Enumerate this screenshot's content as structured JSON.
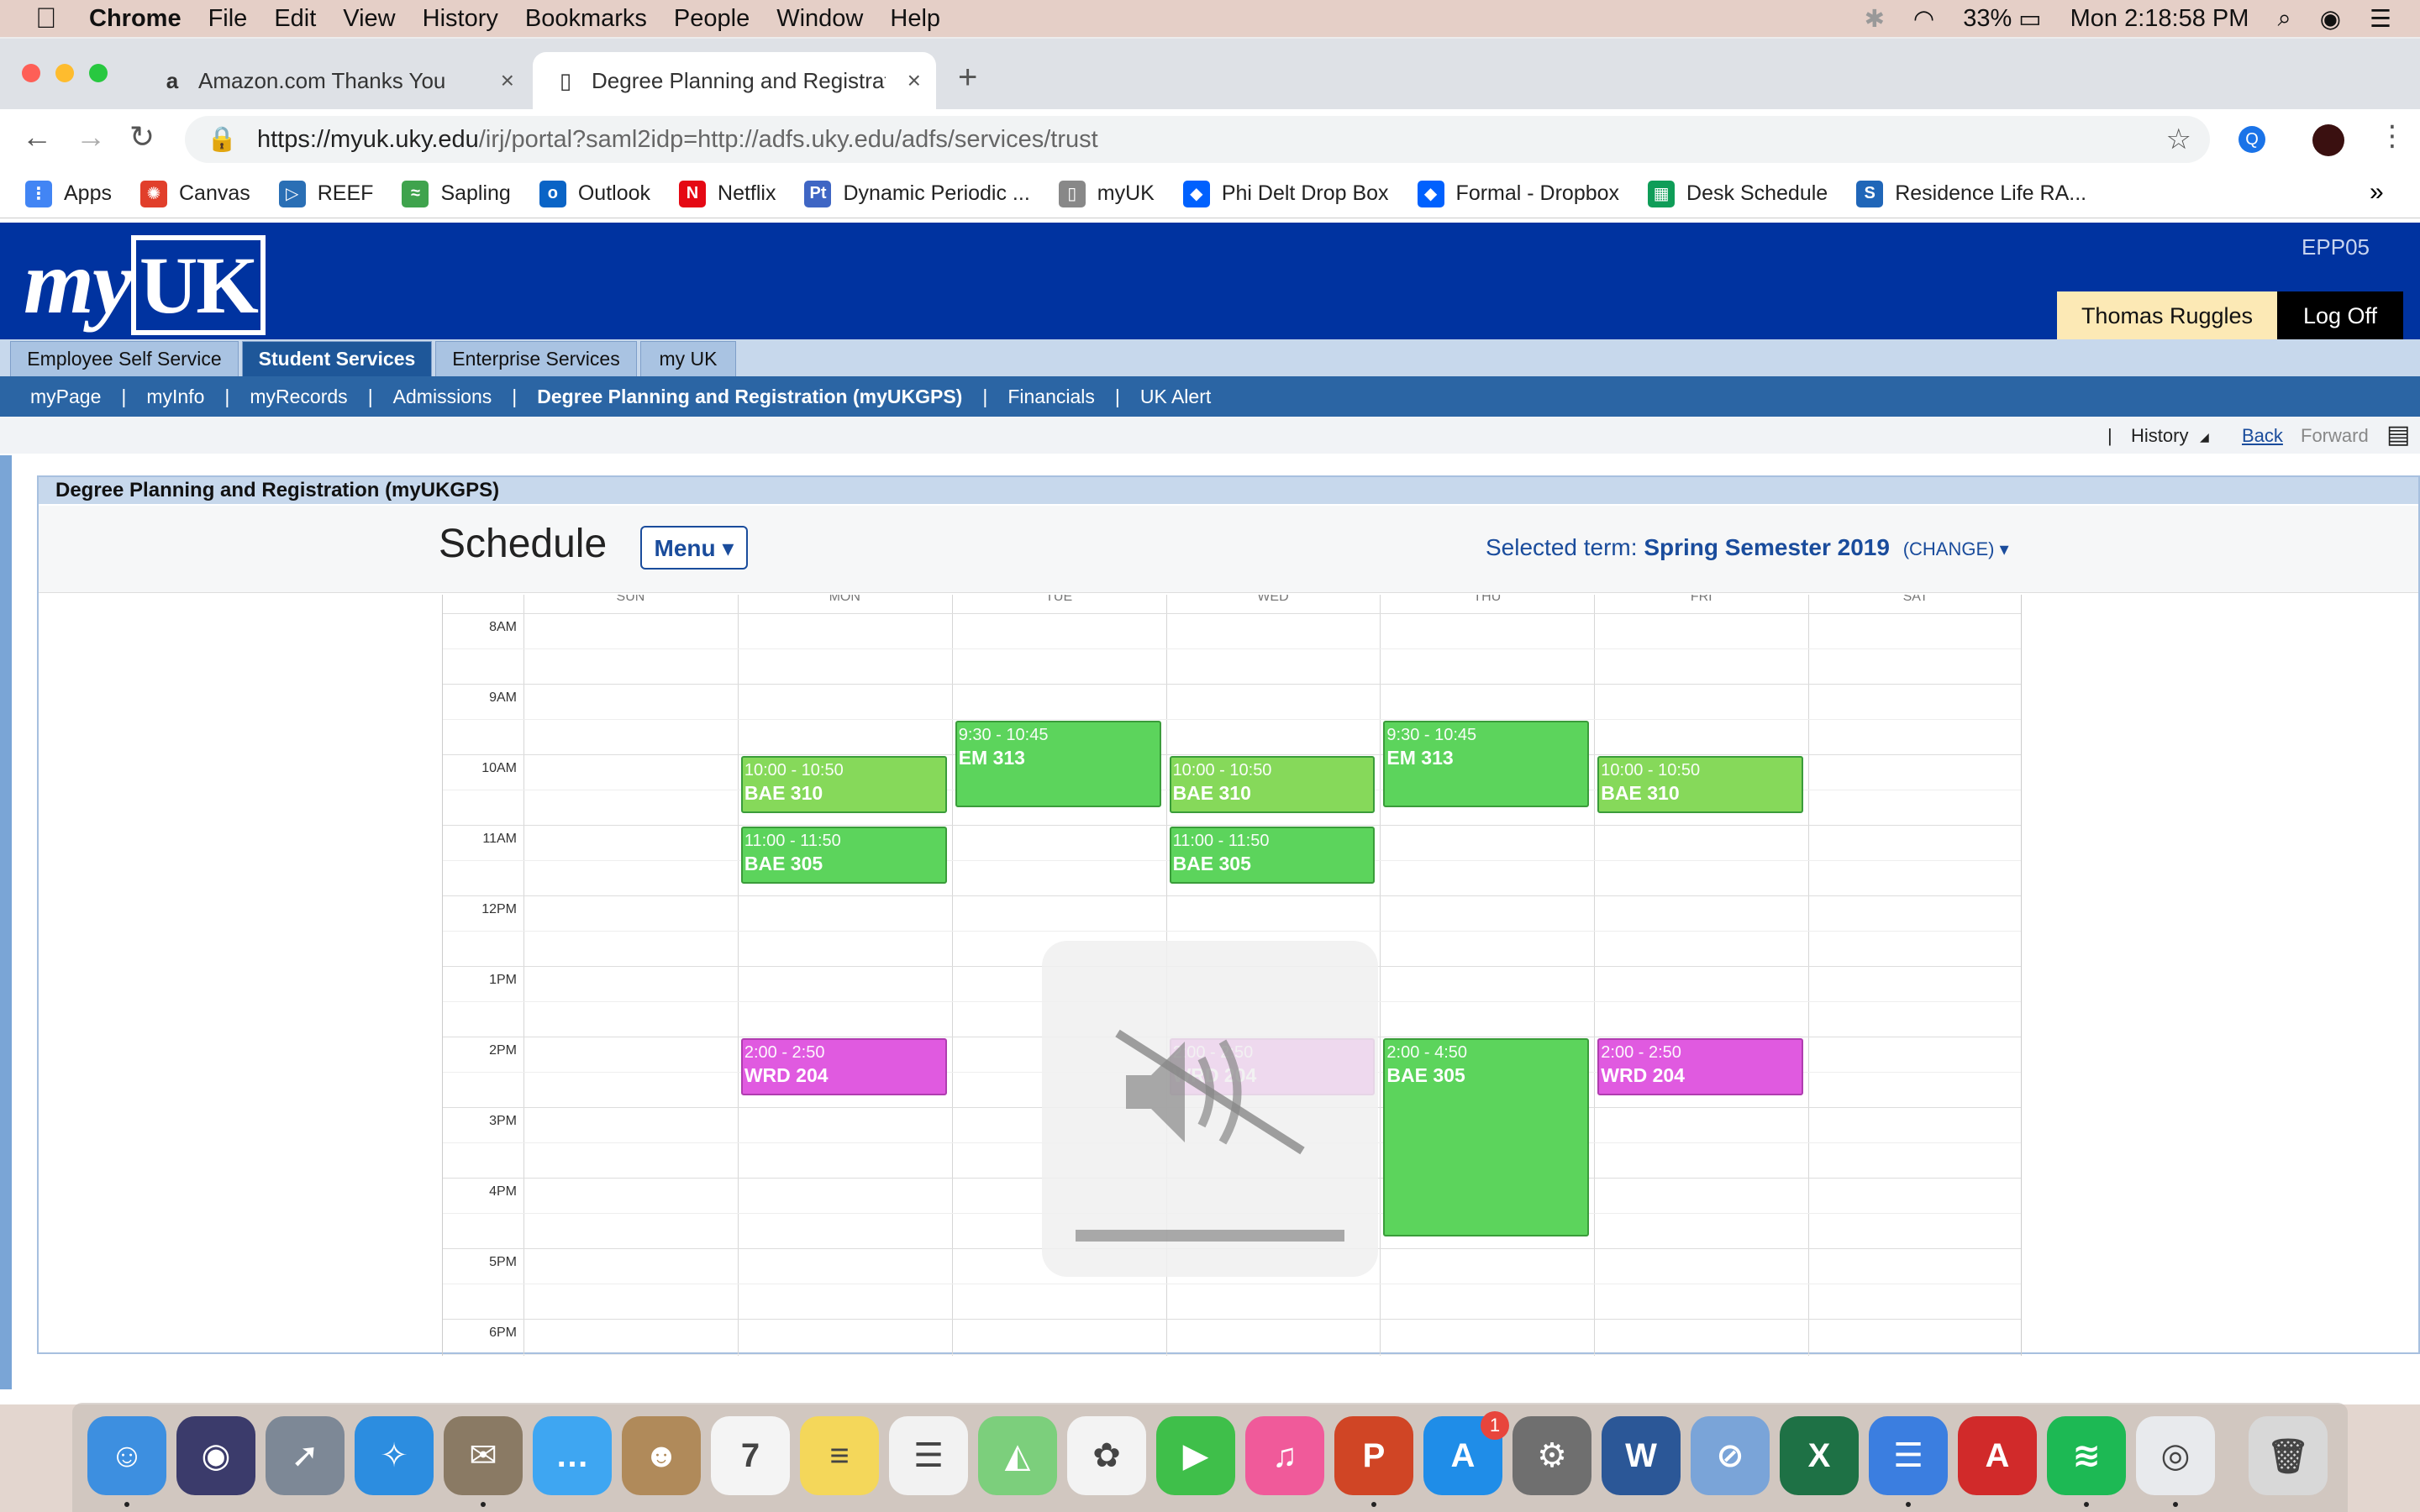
{
  "menubar": {
    "apple": "",
    "app": "Chrome",
    "items": [
      "File",
      "Edit",
      "View",
      "History",
      "Bookmarks",
      "People",
      "Window",
      "Help"
    ],
    "battery": "33%",
    "clock": "Mon 2:18:58 PM"
  },
  "tabs": [
    {
      "favicon": "a",
      "title": "Amazon.com Thanks You",
      "close": "×"
    },
    {
      "favicon": "▯",
      "title": "Degree Planning and Registrati",
      "close": "×"
    }
  ],
  "new_tab": "+",
  "toolbar": {
    "back": "←",
    "forward": "→",
    "reload": "↻",
    "url_host": "https://myuk.uky.edu",
    "url_path": "/irj/portal?saml2idp=http://adfs.uky.edu/adfs/services/trust",
    "star": "☆"
  },
  "bookmarks": [
    {
      "label": "Apps",
      "icon": "apps-grid",
      "color": "#4285f4",
      "glyph": "⋮"
    },
    {
      "label": "Canvas",
      "icon": "canvas",
      "color": "#e13f2b",
      "glyph": "✺"
    },
    {
      "label": "REEF",
      "icon": "reef",
      "color": "#2a6fb5",
      "glyph": "▷"
    },
    {
      "label": "Sapling",
      "icon": "sapling",
      "color": "#3fa34d",
      "glyph": "≈"
    },
    {
      "label": "Outlook",
      "icon": "outlook",
      "color": "#0a64c6",
      "glyph": "o"
    },
    {
      "label": "Netflix",
      "icon": "netflix",
      "color": "#e50914",
      "glyph": "N"
    },
    {
      "label": "Dynamic Periodic ...",
      "icon": "ptable",
      "color": "#3f66c4",
      "glyph": "Pt"
    },
    {
      "label": "myUK",
      "icon": "page",
      "color": "#888888",
      "glyph": "▯"
    },
    {
      "label": "Phi Delt Drop Box",
      "icon": "dropbox",
      "color": "#0061fe",
      "glyph": "◆"
    },
    {
      "label": "Formal - Dropbox",
      "icon": "dropbox",
      "color": "#0061fe",
      "glyph": "◆"
    },
    {
      "label": "Desk Schedule",
      "icon": "sheets",
      "color": "#0f9d58",
      "glyph": "▦"
    },
    {
      "label": "Residence Life RA...",
      "icon": "sharepoint",
      "color": "#2066b8",
      "glyph": "S"
    }
  ],
  "bookmarks_more": "»",
  "portal": {
    "logo_my": "my",
    "logo_uk": "UK",
    "system_id": "EPP05",
    "user": "Thomas Ruggles",
    "logoff": "Log Off",
    "l1_tabs": [
      "Employee Self Service",
      "Student Services",
      "Enterprise Services",
      "my UK"
    ],
    "l2_items": [
      "myPage",
      "myInfo",
      "myRecords",
      "Admissions",
      "Degree Planning and Registration (myUKGPS)",
      "Financials",
      "UK Alert"
    ],
    "history": "History",
    "back": "Back",
    "forward": "Forward",
    "panel_title": "Degree Planning and Registration (myUKGPS)"
  },
  "schedule": {
    "title": "Schedule",
    "menu": "Menu ▾",
    "term_label": "Selected term:",
    "term": "Spring Semester 2019",
    "change": "(CHANGE) ▾",
    "days": [
      "SUN",
      "MON",
      "TUE",
      "WED",
      "THU",
      "FRI",
      "SAT"
    ],
    "hours": [
      "8AM",
      "9AM",
      "10AM",
      "11AM",
      "12PM",
      "1PM",
      "2PM",
      "3PM",
      "4PM",
      "5PM",
      "6PM"
    ],
    "events": [
      {
        "day": 1,
        "start": 10.0,
        "end": 10.83,
        "time": "10:00 - 10:50",
        "course": "BAE 310",
        "color": "#86d95a"
      },
      {
        "day": 1,
        "start": 11.0,
        "end": 11.83,
        "time": "11:00 - 11:50",
        "course": "BAE 305",
        "color": "#5cd45c"
      },
      {
        "day": 1,
        "start": 14.0,
        "end": 14.83,
        "time": "2:00 - 2:50",
        "course": "WRD 204",
        "color": "#e05ae0"
      },
      {
        "day": 2,
        "start": 9.5,
        "end": 10.75,
        "time": "9:30 - 10:45",
        "course": "EM 313",
        "color": "#5cd45c"
      },
      {
        "day": 3,
        "start": 10.0,
        "end": 10.83,
        "time": "10:00 - 10:50",
        "course": "BAE 310",
        "color": "#86d95a"
      },
      {
        "day": 3,
        "start": 11.0,
        "end": 11.83,
        "time": "11:00 - 11:50",
        "course": "BAE 305",
        "color": "#5cd45c"
      },
      {
        "day": 3,
        "start": 14.0,
        "end": 14.83,
        "time": "2:00 - 2:50",
        "course": "WRD 204",
        "color": "#e05ae0"
      },
      {
        "day": 4,
        "start": 9.5,
        "end": 10.75,
        "time": "9:30 - 10:45",
        "course": "EM 313",
        "color": "#5cd45c"
      },
      {
        "day": 4,
        "start": 14.0,
        "end": 16.83,
        "time": "2:00 - 4:50",
        "course": "BAE 305",
        "color": "#5cd45c"
      },
      {
        "day": 5,
        "start": 10.0,
        "end": 10.83,
        "time": "10:00 - 10:50",
        "course": "BAE 310",
        "color": "#86d95a"
      },
      {
        "day": 5,
        "start": 14.0,
        "end": 14.83,
        "time": "2:00 - 2:50",
        "course": "WRD 204",
        "color": "#e05ae0"
      }
    ]
  },
  "overlay": {
    "icon": "speaker-muted"
  },
  "dock": [
    {
      "name": "finder",
      "color": "#3d8fe0",
      "glyph": "☺"
    },
    {
      "name": "siri",
      "color": "#3b3b6b",
      "glyph": "◉"
    },
    {
      "name": "launchpad",
      "color": "#7d8896",
      "glyph": "➚"
    },
    {
      "name": "safari",
      "color": "#2c8de0",
      "glyph": "✧"
    },
    {
      "name": "mail-stamp",
      "color": "#8a7a64",
      "glyph": "✉"
    },
    {
      "name": "messages",
      "color": "#3ea6f2",
      "glyph": "…"
    },
    {
      "name": "contacts",
      "color": "#b08a5a",
      "glyph": "☻"
    },
    {
      "name": "calendar",
      "color": "#f4f4f4",
      "glyph": "7"
    },
    {
      "name": "notes",
      "color": "#f4d75a",
      "glyph": "≡"
    },
    {
      "name": "reminders",
      "color": "#f2f2f2",
      "glyph": "☰"
    },
    {
      "name": "maps",
      "color": "#7ccf7c",
      "glyph": "◭"
    },
    {
      "name": "photos",
      "color": "#f3f3f3",
      "glyph": "✿"
    },
    {
      "name": "facetime",
      "color": "#3fbf4a",
      "glyph": "▶"
    },
    {
      "name": "itunes",
      "color": "#f05a9a",
      "glyph": "♫"
    },
    {
      "name": "powerpoint",
      "color": "#d04525",
      "glyph": "P"
    },
    {
      "name": "app-store",
      "color": "#1f8de8",
      "glyph": "A"
    },
    {
      "name": "system-preferences",
      "color": "#6f6f6f",
      "glyph": "⚙"
    },
    {
      "name": "word",
      "color": "#2b5797",
      "glyph": "W"
    },
    {
      "name": "network",
      "color": "#7aa4d8",
      "glyph": "⊘"
    },
    {
      "name": "excel",
      "color": "#1e7145",
      "glyph": "X"
    },
    {
      "name": "sidebar-app",
      "color": "#3b7ee0",
      "glyph": "☰"
    },
    {
      "name": "autocad",
      "color": "#d12a2a",
      "glyph": "A"
    },
    {
      "name": "spotify",
      "color": "#1db954",
      "glyph": "≋"
    },
    {
      "name": "chrome",
      "color": "#e8eaed",
      "glyph": "◎"
    },
    {
      "name": "trash",
      "color": "#d8d8d8",
      "glyph": "🗑"
    }
  ],
  "appstore_badge": "1"
}
